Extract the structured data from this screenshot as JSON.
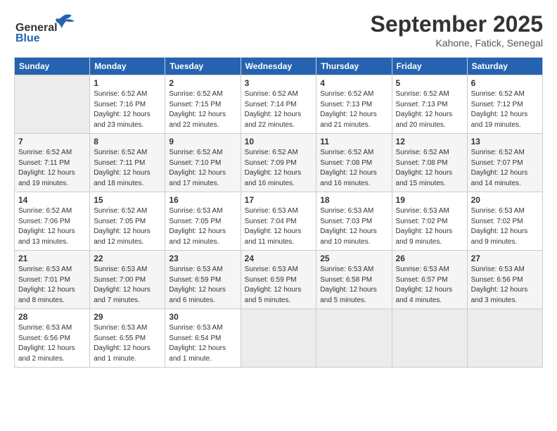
{
  "header": {
    "logo_line1": "General",
    "logo_line2": "Blue",
    "month": "September 2025",
    "location": "Kahone, Fatick, Senegal"
  },
  "days_of_week": [
    "Sunday",
    "Monday",
    "Tuesday",
    "Wednesday",
    "Thursday",
    "Friday",
    "Saturday"
  ],
  "weeks": [
    [
      {
        "day": "",
        "info": ""
      },
      {
        "day": "1",
        "info": "Sunrise: 6:52 AM\nSunset: 7:16 PM\nDaylight: 12 hours\nand 23 minutes."
      },
      {
        "day": "2",
        "info": "Sunrise: 6:52 AM\nSunset: 7:15 PM\nDaylight: 12 hours\nand 22 minutes."
      },
      {
        "day": "3",
        "info": "Sunrise: 6:52 AM\nSunset: 7:14 PM\nDaylight: 12 hours\nand 22 minutes."
      },
      {
        "day": "4",
        "info": "Sunrise: 6:52 AM\nSunset: 7:13 PM\nDaylight: 12 hours\nand 21 minutes."
      },
      {
        "day": "5",
        "info": "Sunrise: 6:52 AM\nSunset: 7:13 PM\nDaylight: 12 hours\nand 20 minutes."
      },
      {
        "day": "6",
        "info": "Sunrise: 6:52 AM\nSunset: 7:12 PM\nDaylight: 12 hours\nand 19 minutes."
      }
    ],
    [
      {
        "day": "7",
        "info": "Sunrise: 6:52 AM\nSunset: 7:11 PM\nDaylight: 12 hours\nand 19 minutes."
      },
      {
        "day": "8",
        "info": "Sunrise: 6:52 AM\nSunset: 7:11 PM\nDaylight: 12 hours\nand 18 minutes."
      },
      {
        "day": "9",
        "info": "Sunrise: 6:52 AM\nSunset: 7:10 PM\nDaylight: 12 hours\nand 17 minutes."
      },
      {
        "day": "10",
        "info": "Sunrise: 6:52 AM\nSunset: 7:09 PM\nDaylight: 12 hours\nand 16 minutes."
      },
      {
        "day": "11",
        "info": "Sunrise: 6:52 AM\nSunset: 7:08 PM\nDaylight: 12 hours\nand 16 minutes."
      },
      {
        "day": "12",
        "info": "Sunrise: 6:52 AM\nSunset: 7:08 PM\nDaylight: 12 hours\nand 15 minutes."
      },
      {
        "day": "13",
        "info": "Sunrise: 6:52 AM\nSunset: 7:07 PM\nDaylight: 12 hours\nand 14 minutes."
      }
    ],
    [
      {
        "day": "14",
        "info": "Sunrise: 6:52 AM\nSunset: 7:06 PM\nDaylight: 12 hours\nand 13 minutes."
      },
      {
        "day": "15",
        "info": "Sunrise: 6:52 AM\nSunset: 7:05 PM\nDaylight: 12 hours\nand 12 minutes."
      },
      {
        "day": "16",
        "info": "Sunrise: 6:53 AM\nSunset: 7:05 PM\nDaylight: 12 hours\nand 12 minutes."
      },
      {
        "day": "17",
        "info": "Sunrise: 6:53 AM\nSunset: 7:04 PM\nDaylight: 12 hours\nand 11 minutes."
      },
      {
        "day": "18",
        "info": "Sunrise: 6:53 AM\nSunset: 7:03 PM\nDaylight: 12 hours\nand 10 minutes."
      },
      {
        "day": "19",
        "info": "Sunrise: 6:53 AM\nSunset: 7:02 PM\nDaylight: 12 hours\nand 9 minutes."
      },
      {
        "day": "20",
        "info": "Sunrise: 6:53 AM\nSunset: 7:02 PM\nDaylight: 12 hours\nand 9 minutes."
      }
    ],
    [
      {
        "day": "21",
        "info": "Sunrise: 6:53 AM\nSunset: 7:01 PM\nDaylight: 12 hours\nand 8 minutes."
      },
      {
        "day": "22",
        "info": "Sunrise: 6:53 AM\nSunset: 7:00 PM\nDaylight: 12 hours\nand 7 minutes."
      },
      {
        "day": "23",
        "info": "Sunrise: 6:53 AM\nSunset: 6:59 PM\nDaylight: 12 hours\nand 6 minutes."
      },
      {
        "day": "24",
        "info": "Sunrise: 6:53 AM\nSunset: 6:59 PM\nDaylight: 12 hours\nand 5 minutes."
      },
      {
        "day": "25",
        "info": "Sunrise: 6:53 AM\nSunset: 6:58 PM\nDaylight: 12 hours\nand 5 minutes."
      },
      {
        "day": "26",
        "info": "Sunrise: 6:53 AM\nSunset: 6:57 PM\nDaylight: 12 hours\nand 4 minutes."
      },
      {
        "day": "27",
        "info": "Sunrise: 6:53 AM\nSunset: 6:56 PM\nDaylight: 12 hours\nand 3 minutes."
      }
    ],
    [
      {
        "day": "28",
        "info": "Sunrise: 6:53 AM\nSunset: 6:56 PM\nDaylight: 12 hours\nand 2 minutes."
      },
      {
        "day": "29",
        "info": "Sunrise: 6:53 AM\nSunset: 6:55 PM\nDaylight: 12 hours\nand 1 minute."
      },
      {
        "day": "30",
        "info": "Sunrise: 6:53 AM\nSunset: 6:54 PM\nDaylight: 12 hours\nand 1 minute."
      },
      {
        "day": "",
        "info": ""
      },
      {
        "day": "",
        "info": ""
      },
      {
        "day": "",
        "info": ""
      },
      {
        "day": "",
        "info": ""
      }
    ]
  ]
}
